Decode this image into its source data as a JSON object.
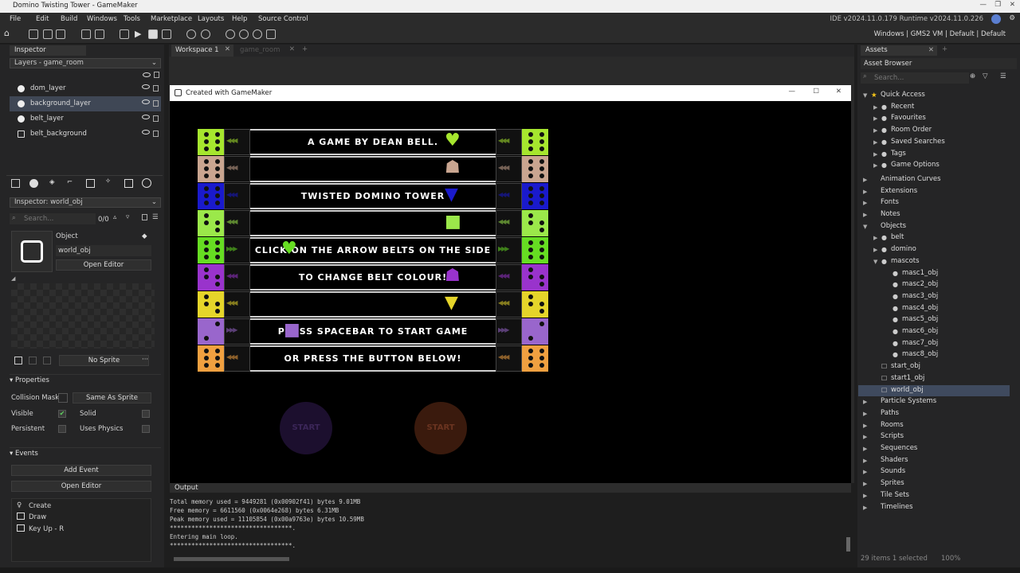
{
  "window": {
    "title": "Domino Twisting Tower - GameMaker",
    "version": "IDE v2024.11.0.179  Runtime v2024.11.0.226"
  },
  "menu": [
    "File",
    "Edit",
    "Build",
    "Windows",
    "Tools",
    "Marketplace",
    "Layouts",
    "Help",
    "Source Control"
  ],
  "targets": "Windows | GMS2 VM | Default | Default",
  "left": {
    "inspector_tab": "Inspector",
    "layers_dropdown": "Layers - game_room",
    "layers": [
      "dom_layer",
      "background_layer",
      "belt_layer",
      "belt_background"
    ],
    "inspector2": "Inspector: world_obj",
    "search_placeholder": "Search...",
    "search_count": "0/0",
    "object_label": "Object",
    "object_name": "world_obj",
    "open_editor": "Open Editor",
    "no_sprite": "No Sprite",
    "properties": "Properties",
    "collision_mask": "Collision Mask",
    "same_as_sprite": "Same As Sprite",
    "visible": "Visible",
    "solid": "Solid",
    "persistent": "Persistent",
    "uses_physics": "Uses Physics",
    "events_title": "Events",
    "add_event": "Add Event",
    "open_editor2": "Open Editor",
    "events": [
      "Create",
      "Draw",
      "Key Up - R"
    ]
  },
  "tabs": {
    "workspace": "Workspace 1",
    "room": "game_room"
  },
  "game": {
    "title": "Created with GameMaker",
    "lines": [
      "A GAME BY DEAN BELL.",
      "",
      "TWISTED DOMINO TOWER",
      "",
      "CLICK ON THE ARROW BELTS ON THE SIDE",
      "TO CHANGE BELT COLOUR!",
      "",
      "PRESS SPACEBAR TO START GAME",
      "OR PRESS THE BUTTON BELOW!"
    ],
    "row_colors": [
      "#a6e62e",
      "#c9a590",
      "#1a1acc",
      "#9be84a",
      "#66dd22",
      "#9933cc",
      "#e5d52a",
      "#9966cc",
      "#f0a040"
    ],
    "button1": "START",
    "button2": "START"
  },
  "output": {
    "title": "Output",
    "lines": [
      "Total memory used = 9449281 (0x00902f41) bytes 9.01MB",
      "Free memory = 6611560 (0x0064e268) bytes 6.31MB",
      "Peak memory used = 11105854 (0x00a9763e) bytes 10.59MB",
      "**********************************.",
      "Entering main loop.",
      "**********************************."
    ]
  },
  "assets": {
    "tab": "Assets",
    "browser": "Asset Browser",
    "search_placeholder": "Search...",
    "quick_access": "Quick Access",
    "quick": [
      "Recent",
      "Favourites",
      "Room Order",
      "Saved Searches",
      "Tags",
      "Game Options"
    ],
    "groups1": [
      "Animation Curves",
      "Extensions",
      "Fonts",
      "Notes"
    ],
    "objects": "Objects",
    "obj_folders": [
      "belt",
      "domino"
    ],
    "mascots": "mascots",
    "masc": [
      "masc1_obj",
      "masc2_obj",
      "masc3_obj",
      "masc4_obj",
      "masc5_obj",
      "masc6_obj",
      "masc7_obj",
      "masc8_obj"
    ],
    "obj_items": [
      "start_obj",
      "start1_obj",
      "world_obj"
    ],
    "groups2": [
      "Particle Systems",
      "Paths",
      "Rooms",
      "Scripts",
      "Sequences",
      "Shaders",
      "Sounds",
      "Sprites",
      "Tile Sets",
      "Timelines"
    ],
    "footer_left": "29 items   1 selected",
    "footer_zoom": "100%"
  }
}
